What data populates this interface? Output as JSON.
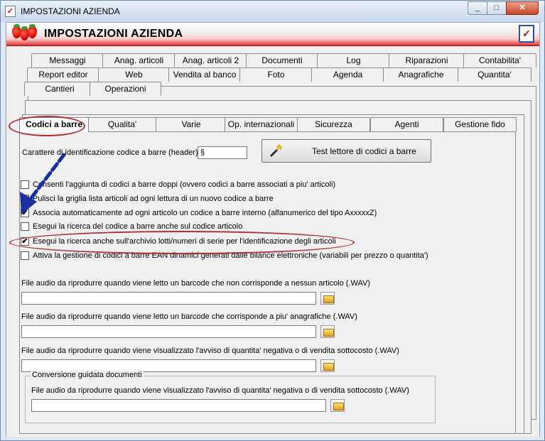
{
  "window": {
    "title": "IMPOSTAZIONI AZIENDA",
    "min": "_",
    "max": "□",
    "close": "✕"
  },
  "header": {
    "title": "IMPOSTAZIONI AZIENDA"
  },
  "tabs": {
    "row1": [
      "Messaggi",
      "Anag. articoli",
      "Anag. articoli 2",
      "Documenti",
      "Log",
      "Riparazioni",
      "Contabilita'"
    ],
    "row2": [
      "Report editor",
      "Web",
      "Vendita al banco",
      "Foto",
      "Agenda",
      "Anagrafiche",
      "Quantita'"
    ],
    "row3": [
      "Cantieri",
      "Operazioni"
    ],
    "row4": [
      "Codici a barre",
      "Qualita'",
      "Varie",
      "Op. internazionali",
      "Sicurezza",
      "Agenti",
      "Gestione fido"
    ]
  },
  "panel": {
    "header_char_label": "Carattere di identificazione codice a barre (header) :",
    "header_char_value": "§",
    "test_button": "Test lettore di codici a barre",
    "checkboxes": [
      {
        "label": "Consenti l'aggiunta di codici a barre doppi (ovvero codici a barre associati a piu' articoli)",
        "checked": false,
        "mark": ""
      },
      {
        "label": "Pulisci la griglia lista articoli ad ogni lettura di un nuovo codice a barre",
        "checked": true,
        "mark": "✔"
      },
      {
        "label": "Associa automaticamente ad ogni articolo un codice a barre interno (alfanumerico del tipo AxxxxxZ)",
        "checked": true,
        "mark": "✔"
      },
      {
        "label": "Esegui la ricerca del codice a barre anche sul codice articolo",
        "checked": false,
        "mark": ""
      },
      {
        "label": "Esegui la ricerca anche sull'archivio lotti/numeri di serie per l'identificazione degli articoli",
        "checked": true,
        "mark": "✔"
      },
      {
        "label": "Attiva la gestione di codici a barre EAN dinamici generati dalle bilance elettroniche (variabili per prezzo o quantita')",
        "checked": false,
        "mark": ""
      }
    ],
    "audio1_label": "File audio da riprodurre quando viene letto un barcode che non corrisponde a nessun articolo (.WAV)",
    "audio1_value": "",
    "audio2_label": "File audio da riprodurre quando viene letto un barcode che corrisponde a piu' anagrafiche (.WAV)",
    "audio2_value": "",
    "audio3_label": "File audio da riprodurre quando viene visualizzato l'avviso di quantita' negativa o di vendita sottocosto (.WAV)",
    "audio3_value": "",
    "group_title": "Conversione guidata documenti",
    "audio4_label": "File audio da riprodurre quando viene visualizzato l'avviso di quantita' negativa o di vendita sottocosto (.WAV)",
    "audio4_value": ""
  },
  "colors": {
    "header_red": "#e03030",
    "annotation": "#b03030",
    "arrow": "#1a2fa0"
  }
}
